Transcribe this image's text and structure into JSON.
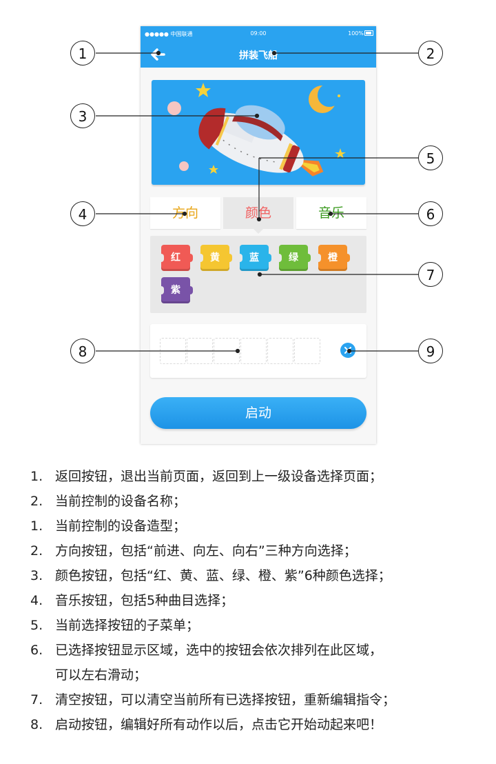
{
  "status_bar": {
    "carrier": "●●●●● 中国联通",
    "time": "09:00",
    "battery": "100%"
  },
  "nav": {
    "title": "拼装飞船"
  },
  "tabs": [
    {
      "label": "方向",
      "color": "#e8a516"
    },
    {
      "label": "颜色",
      "color": "#f16262"
    },
    {
      "label": "音乐",
      "color": "#3a9a1e"
    }
  ],
  "color_blocks": [
    {
      "label": "红",
      "color": "#f05a55"
    },
    {
      "label": "黄",
      "color": "#f5c631"
    },
    {
      "label": "蓝",
      "color": "#2ab4ea"
    },
    {
      "label": "绿",
      "color": "#6fbd3b"
    },
    {
      "label": "橙",
      "color": "#f5912b"
    },
    {
      "label": "紫",
      "color": "#7953a8"
    }
  ],
  "start_button": {
    "label": "启动"
  },
  "callouts": [
    "1",
    "2",
    "3",
    "4",
    "5",
    "6",
    "7",
    "8",
    "9"
  ],
  "notes": [
    {
      "num": "1.",
      "text": "返回按钮，退出当前页面，返回到上一级设备选择页面；"
    },
    {
      "num": "2.",
      "text": "当前控制的设备名称；"
    },
    {
      "num": "1.",
      "text": "当前控制的设备造型；"
    },
    {
      "num": "2.",
      "text": "方向按钮，包括“前进、向左、向右”三种方向选择；"
    },
    {
      "num": "3.",
      "text": "颜色按钮，包括“红、黄、蓝、绿、橙、紫”6种颜色选择；"
    },
    {
      "num": "4.",
      "text": "音乐按钮，包括5种曲目选择；"
    },
    {
      "num": "5.",
      "text": "当前选择按钮的子菜单；"
    },
    {
      "num": "6.",
      "text": "已选择按钮显示区域，选中的按钮会依次排列在此区域，"
    },
    {
      "num": "",
      "text": "可以左右滑动；"
    },
    {
      "num": "7.",
      "text": "清空按钮，可以清空当前所有已选择按钮，重新编辑指令；"
    },
    {
      "num": "8.",
      "text": "启动按钮，编辑好所有动作以后，点击它开始动起来吧！"
    }
  ]
}
